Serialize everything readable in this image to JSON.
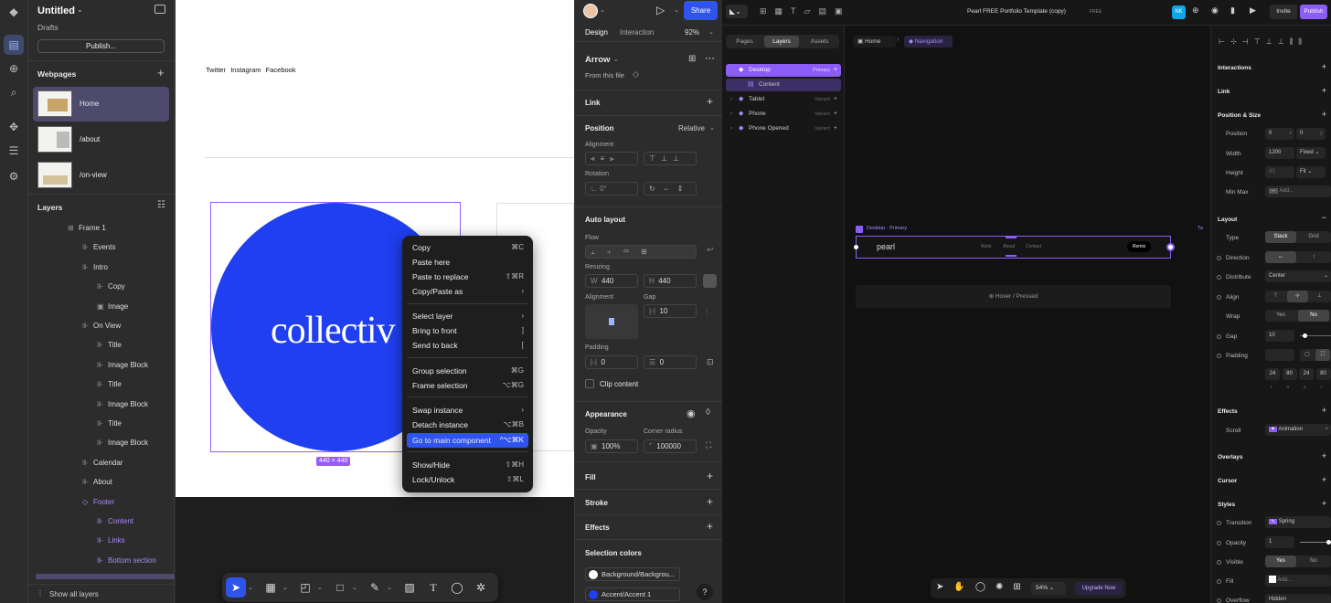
{
  "figma": {
    "file_title": "Untitled",
    "drafts": "Drafts",
    "publish": "Publish...",
    "webpages_label": "Webpages",
    "pages": [
      "Home",
      "/about",
      "/on-view"
    ],
    "layers_label": "Layers",
    "layers": [
      {
        "label": "Frame 1",
        "indent": 0
      },
      {
        "label": "Events",
        "indent": 1
      },
      {
        "label": "Intro",
        "indent": 1
      },
      {
        "label": "Copy",
        "indent": 2
      },
      {
        "label": "Image",
        "indent": 2
      },
      {
        "label": "On View",
        "indent": 1
      },
      {
        "label": "Title",
        "indent": 2
      },
      {
        "label": "Image Block",
        "indent": 2
      },
      {
        "label": "Title",
        "indent": 2
      },
      {
        "label": "Image Block",
        "indent": 2
      },
      {
        "label": "Title",
        "indent": 2
      },
      {
        "label": "Image Block",
        "indent": 2
      },
      {
        "label": "Calendar",
        "indent": 1
      },
      {
        "label": "About",
        "indent": 1
      },
      {
        "label": "Footer",
        "indent": 1,
        "purple": true
      },
      {
        "label": "Content",
        "indent": 2,
        "purple": true
      },
      {
        "label": "Links",
        "indent": 2,
        "purple": true
      },
      {
        "label": "Bottom section",
        "indent": 2,
        "purple": true
      }
    ],
    "show_all": "Show all layers",
    "canvas": {
      "links": [
        "Twitter",
        "Instagram",
        "Facebook"
      ],
      "logo": "collectiv",
      "size": "440 × 440"
    },
    "context_menu": [
      {
        "label": "Copy",
        "sc": "⌘C"
      },
      {
        "label": "Paste here",
        "sc": ""
      },
      {
        "label": "Paste to replace",
        "sc": "⇧⌘R"
      },
      {
        "label": "Copy/Paste as",
        "sc": "›"
      },
      {
        "label": "Select layer",
        "sc": "›"
      },
      {
        "label": "Bring to front",
        "sc": "]"
      },
      {
        "label": "Send to back",
        "sc": "["
      },
      {
        "label": "Group selection",
        "sc": "⌘G"
      },
      {
        "label": "Frame selection",
        "sc": "⌥⌘G"
      },
      {
        "label": "Swap instance",
        "sc": "›"
      },
      {
        "label": "Detach instance",
        "sc": "⌥⌘B"
      },
      {
        "label": "Go to main component",
        "sc": "^⌥⌘K"
      },
      {
        "label": "Show/Hide",
        "sc": "⇧⌘H"
      },
      {
        "label": "Lock/Unlock",
        "sc": "⇧⌘L"
      }
    ],
    "right": {
      "share": "Share",
      "tab_design": "Design",
      "tab_interaction": "Interaction",
      "zoom": "92%",
      "component": "Arrow",
      "from_file": "From this file",
      "link": "Link",
      "position": "Position",
      "position_mode": "Relative",
      "alignment": "Alignment",
      "rotation": "Rotation",
      "rotation_val": "0°",
      "auto_layout": "Auto layout",
      "flow": "Flow",
      "resizing": "Resizing",
      "w_label": "W",
      "w_val": "440",
      "h_label": "H",
      "h_val": "440",
      "align_label": "Alignment",
      "gap_label": "Gap",
      "gap_val": "10",
      "padding": "Padding",
      "pad_h": "0",
      "pad_v": "0",
      "clip": "Clip content",
      "appearance": "Appearance",
      "opacity": "Opacity",
      "opacity_val": "100%",
      "radius": "Corner radius",
      "radius_val": "100000",
      "fill": "Fill",
      "stroke": "Stroke",
      "effects": "Effects",
      "sel_colors": "Selection colors",
      "color1": "Background/Backgrou...",
      "color2": "Accent/Accent 1",
      "help": "?"
    }
  },
  "framer": {
    "title": "Pearl FREE Portfolio Template (copy)",
    "free": "FREE",
    "avatar": "NK",
    "invite": "Invite",
    "publish": "Publish",
    "tabs": [
      "Pages",
      "Layers",
      "Assets"
    ],
    "layers": [
      {
        "label": "Desktop",
        "variant": "Primary"
      },
      {
        "label": "Content",
        "variant": ""
      },
      {
        "label": "Tablet",
        "variant": "Variant"
      },
      {
        "label": "Phone",
        "variant": "Variant"
      },
      {
        "label": "Phone Opened",
        "variant": "Variant"
      }
    ],
    "crumbs": [
      "Home",
      "Navigation"
    ],
    "frame_label": "Desktop · Primary",
    "logo": "pearl",
    "nav": [
      "Work",
      "About",
      "Contact"
    ],
    "remix": "Remix",
    "hover": "Hover / Pressed",
    "tablet_tag": "Ta",
    "zoom": "54%",
    "upgrade": "Upgrade Now",
    "right": {
      "interactions": "Interactions",
      "link": "Link",
      "pos_size": "Position & Size",
      "position": "Position",
      "px": "0",
      "py": "0",
      "x": "x",
      "y": "y",
      "width": "Width",
      "w": "1200",
      "w_mode": "Fixed",
      "height": "Height",
      "h": "83",
      "h_mode": "Fit",
      "minmax": "Min Max",
      "add": "Add...",
      "layout": "Layout",
      "type": "Type",
      "stack": "Stack",
      "grid": "Grid",
      "direction": "Direction",
      "distribute": "Distribute",
      "distribute_val": "Center",
      "align": "Align",
      "wrap": "Wrap",
      "yes": "Yes",
      "no": "No",
      "gap": "Gap",
      "gap_val": "10",
      "padding": "Padding",
      "pads": [
        "24",
        "80",
        "24",
        "80"
      ],
      "pad_keys": [
        "T",
        "R",
        "B",
        "L"
      ],
      "effects": "Effects",
      "scroll": "Scroll",
      "animation": "Animation",
      "overlays": "Overlays",
      "cursor": "Cursor",
      "styles": "Styles",
      "transition": "Transition",
      "spring": "Spring",
      "opacity": "Opacity",
      "opacity_val": "1",
      "visible": "Visible",
      "fill": "Fill",
      "overflow": "Overflow",
      "hidden": "Hidden"
    }
  }
}
